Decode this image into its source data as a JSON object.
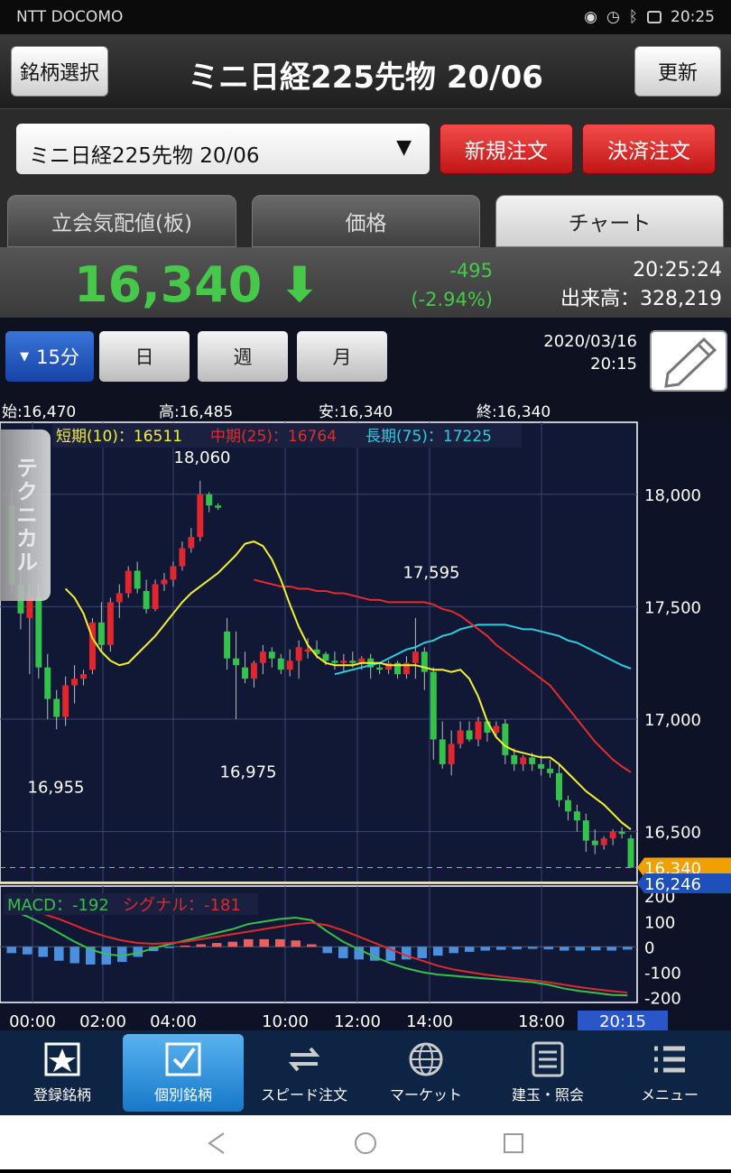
{
  "statusbar": {
    "carrier": "NTT DOCOMO",
    "time": "20:25"
  },
  "header": {
    "left_button": "銘柄選択",
    "title": "ミニ日経225先物 20/06",
    "right_button": "更新"
  },
  "selector": {
    "value": "ミニ日経225先物 20/06",
    "new_order": "新規注文",
    "settle_order": "決済注文"
  },
  "tabs": [
    {
      "label": "立会気配値(板)"
    },
    {
      "label": "価格"
    },
    {
      "label": "チャート"
    }
  ],
  "price": {
    "last": "16,340",
    "arrow": "⬇",
    "change": "-495",
    "change_pct": "(-2.94%)",
    "time": "20:25:24",
    "volume": "出来高：328,219"
  },
  "periods": [
    {
      "label": "15分"
    },
    {
      "label": "日"
    },
    {
      "label": "週"
    },
    {
      "label": "月"
    }
  ],
  "datetime": {
    "date": "2020/03/16",
    "time": "20:15"
  },
  "ohlc": {
    "open": "始:16,470",
    "high": "高:16,485",
    "low": "安:16,340",
    "close": "終:16,340"
  },
  "legend": {
    "short": "短期(10)：16511",
    "mid": "中期(25)：16764",
    "long": "長期(75)：17225"
  },
  "side_tab": "テクニカル",
  "macd_legend": {
    "macd": "MACD：-192",
    "signal": "シグナル：-181"
  },
  "colors": {
    "up": "#e3262e",
    "down": "#33c24a",
    "short_ma": "#f4f22c",
    "mid_ma": "#e52b2b",
    "long_ma": "#2ad0e0",
    "accent_blue": "#1f4fb8",
    "price_tag": "#f0a000"
  },
  "chart_data": {
    "type": "candlestick",
    "y_axis": {
      "ticks": [
        18000,
        17500,
        17000,
        16500
      ],
      "ylim": [
        16270,
        18320
      ]
    },
    "macd_axis": {
      "ticks": [
        200,
        100,
        0,
        -100,
        -200
      ],
      "ylim": [
        -220,
        240
      ]
    },
    "x_ticks": [
      "00:00",
      "02:00",
      "04:00",
      "10:00",
      "12:00",
      "14:00",
      "18:00"
    ],
    "current_x_label": "20:15",
    "price_tags": [
      "16,340",
      "16,246"
    ],
    "annotations": [
      "18,060",
      "16,955",
      "16,975",
      "17,595"
    ],
    "candles": [
      [
        17950,
        18030,
        17560,
        17600
      ],
      [
        17600,
        17680,
        17400,
        17470
      ],
      [
        17450,
        17600,
        17200,
        17550
      ],
      [
        17540,
        17600,
        17180,
        17230
      ],
      [
        17230,
        17290,
        17000,
        17090
      ],
      [
        17090,
        17130,
        16955,
        17010
      ],
      [
        17010,
        17190,
        16970,
        17150
      ],
      [
        17150,
        17240,
        17070,
        17180
      ],
      [
        17180,
        17220,
        17150,
        17200
      ],
      [
        17220,
        17450,
        17200,
        17430
      ],
      [
        17430,
        17520,
        17300,
        17330
      ],
      [
        17330,
        17540,
        17300,
        17520
      ],
      [
        17520,
        17600,
        17450,
        17560
      ],
      [
        17560,
        17680,
        17540,
        17660
      ],
      [
        17660,
        17700,
        17560,
        17580
      ],
      [
        17570,
        17620,
        17470,
        17490
      ],
      [
        17490,
        17620,
        17480,
        17600
      ],
      [
        17600,
        17650,
        17570,
        17620
      ],
      [
        17620,
        17700,
        17590,
        17680
      ],
      [
        17680,
        17790,
        17660,
        17760
      ],
      [
        17760,
        17850,
        17740,
        17810
      ],
      [
        17810,
        18060,
        17790,
        18000
      ],
      [
        18000,
        18010,
        17920,
        17950
      ],
      [
        17950,
        17960,
        17930,
        17940
      ],
      [
        17390,
        17450,
        17220,
        17270
      ],
      [
        17270,
        17390,
        17000,
        17240
      ],
      [
        17230,
        17300,
        17160,
        17180
      ],
      [
        17180,
        17260,
        17140,
        17250
      ],
      [
        17250,
        17330,
        17200,
        17300
      ],
      [
        17300,
        17320,
        17230,
        17270
      ],
      [
        17270,
        17290,
        17200,
        17220
      ],
      [
        17220,
        17310,
        17190,
        17260
      ],
      [
        17260,
        17350,
        17180,
        17320
      ],
      [
        17300,
        17360,
        17270,
        17310
      ],
      [
        17310,
        17350,
        17270,
        17290
      ],
      [
        17290,
        17300,
        17240,
        17260
      ],
      [
        17260,
        17300,
        17220,
        17250
      ],
      [
        17250,
        17290,
        17210,
        17260
      ],
      [
        17260,
        17300,
        17230,
        17250
      ],
      [
        17250,
        17280,
        17220,
        17270
      ],
      [
        17270,
        17290,
        17180,
        17230
      ],
      [
        17230,
        17250,
        17200,
        17220
      ],
      [
        17220,
        17260,
        17200,
        17250
      ],
      [
        17250,
        17260,
        17180,
        17200
      ],
      [
        17200,
        17280,
        17180,
        17250
      ],
      [
        17250,
        17450,
        17180,
        17300
      ],
      [
        17300,
        17320,
        17130,
        17210
      ],
      [
        17210,
        17230,
        16820,
        16910
      ],
      [
        16910,
        16990,
        16780,
        16800
      ],
      [
        16800,
        16950,
        16750,
        16890
      ],
      [
        16890,
        16990,
        16870,
        16950
      ],
      [
        16950,
        16990,
        16900,
        16910
      ],
      [
        16910,
        17010,
        16880,
        16990
      ],
      [
        16990,
        17000,
        16900,
        16940
      ],
      [
        16940,
        16990,
        16920,
        16970
      ],
      [
        16980,
        17000,
        16800,
        16840
      ],
      [
        16840,
        16870,
        16770,
        16800
      ],
      [
        16800,
        16840,
        16770,
        16830
      ],
      [
        16830,
        16850,
        16770,
        16800
      ],
      [
        16800,
        16840,
        16750,
        16780
      ],
      [
        16780,
        16820,
        16740,
        16760
      ],
      [
        16760,
        16800,
        16610,
        16640
      ],
      [
        16640,
        16660,
        16550,
        16590
      ],
      [
        16590,
        16620,
        16500,
        16550
      ],
      [
        16550,
        16580,
        16410,
        16460
      ],
      [
        16460,
        16510,
        16400,
        16440
      ],
      [
        16440,
        16480,
        16420,
        16470
      ],
      [
        16470,
        16510,
        16440,
        16500
      ],
      [
        16500,
        16520,
        16470,
        16490
      ],
      [
        16470,
        16485,
        16340,
        16340
      ]
    ],
    "ma_short": [
      17580,
      17540,
      17470,
      17360,
      17300,
      17260,
      17240,
      17250,
      17290,
      17330,
      17370,
      17420,
      17470,
      17520,
      17560,
      17590,
      17620,
      17650,
      17690,
      17730,
      17780,
      17790,
      17770,
      17710,
      17620,
      17510,
      17410,
      17330,
      17280,
      17250,
      17240,
      17240,
      17240,
      17250,
      17250,
      17250,
      17240,
      17240,
      17240,
      17240,
      17230,
      17220,
      17220,
      17210,
      17220,
      17180,
      17100,
      16990,
      16920,
      16880,
      16860,
      16850,
      16840,
      16830,
      16830,
      16800,
      16760,
      16720,
      16680,
      16650,
      16620,
      16580,
      16540,
      16510
    ],
    "ma_mid": [
      17620,
      17610,
      17600,
      17590,
      17590,
      17580,
      17580,
      17570,
      17570,
      17560,
      17560,
      17550,
      17540,
      17530,
      17530,
      17520,
      17520,
      17520,
      17520,
      17520,
      17510,
      17490,
      17480,
      17460,
      17430,
      17400,
      17370,
      17330,
      17300,
      17270,
      17240,
      17210,
      17180,
      17150,
      17100,
      17050,
      17000,
      16950,
      16900,
      16860,
      16820,
      16790,
      16764
    ],
    "ma_long": [
      17200,
      17210,
      17220,
      17230,
      17240,
      17250,
      17270,
      17290,
      17310,
      17320,
      17340,
      17350,
      17370,
      17380,
      17400,
      17410,
      17420,
      17420,
      17420,
      17420,
      17410,
      17400,
      17400,
      17390,
      17380,
      17370,
      17350,
      17340,
      17320,
      17300,
      17280,
      17260,
      17240,
      17225
    ],
    "macd": [
      145,
      120,
      90,
      55,
      20,
      -10,
      -30,
      -35,
      -25,
      -5,
      10,
      25,
      40,
      55,
      70,
      90,
      100,
      110,
      115,
      105,
      60,
      20,
      -10,
      -40,
      -65,
      -85,
      -100,
      -110,
      -115,
      -120,
      -125,
      -130,
      -135,
      -140,
      -150,
      -165,
      -175,
      -182,
      -190,
      -192
    ],
    "signal": [
      170,
      150,
      130,
      110,
      85,
      60,
      40,
      25,
      15,
      12,
      15,
      20,
      30,
      40,
      50,
      60,
      70,
      80,
      90,
      95,
      85,
      65,
      40,
      15,
      -10,
      -35,
      -55,
      -75,
      -90,
      -100,
      -110,
      -118,
      -125,
      -132,
      -140,
      -150,
      -160,
      -168,
      -175,
      -181
    ],
    "histogram": [
      -25,
      -30,
      -40,
      -55,
      -65,
      -70,
      -70,
      -60,
      -40,
      -17,
      -5,
      5,
      10,
      15,
      20,
      30,
      30,
      30,
      25,
      10,
      -25,
      -45,
      -50,
      -55,
      -55,
      -50,
      -45,
      -35,
      -25,
      -20,
      -15,
      -12,
      -10,
      -8,
      -10,
      -15,
      -15,
      -14,
      -15,
      -11
    ]
  },
  "nav": [
    {
      "label": "登録銘柄",
      "icon": "star-icon"
    },
    {
      "label": "個別銘柄",
      "icon": "checkbox-icon"
    },
    {
      "label": "スピード注文",
      "icon": "swap-arrows-icon"
    },
    {
      "label": "マーケット",
      "icon": "globe-icon"
    },
    {
      "label": "建玉・照会",
      "icon": "document-icon"
    },
    {
      "label": "メニュー",
      "icon": "list-menu-icon"
    }
  ]
}
